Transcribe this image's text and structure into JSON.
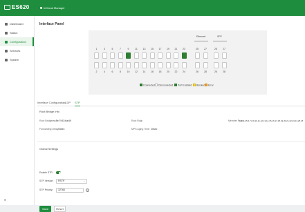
{
  "app": {
    "logo": "ES620",
    "brand": "InCloud Manager"
  },
  "sidebar": {
    "items": [
      {
        "label": "Dashboard",
        "icon": "dashboard-icon"
      },
      {
        "label": "Status",
        "icon": "status-icon"
      },
      {
        "label": "Configuration",
        "icon": "configuration-icon",
        "active": true
      },
      {
        "label": "Services",
        "icon": "services-icon"
      },
      {
        "label": "System",
        "icon": "system-icon"
      }
    ],
    "collapse_glyph": "≡"
  },
  "page": {
    "title": "Interface Panel"
  },
  "panel": {
    "top_ports": [
      "1",
      "3",
      "5",
      "7",
      "9",
      "11",
      "13",
      "15",
      "17",
      "19",
      "21",
      "23"
    ],
    "bottom_ports": [
      "2",
      "4",
      "6",
      "8",
      "10",
      "12",
      "14",
      "16",
      "18",
      "20",
      "22",
      "24"
    ],
    "connected_top": [
      "9",
      "23"
    ],
    "ethernet": {
      "label": "Ethernet",
      "ports": [
        "25",
        "27"
      ],
      "bottom_ports": [
        "26",
        "28"
      ]
    },
    "sfp": {
      "label": "SFP",
      "ports": [
        "25",
        "27"
      ],
      "bottom_ports": [
        "26",
        "28"
      ]
    }
  },
  "legend": {
    "items": [
      {
        "label": "Connected",
        "color": "#2e7d32"
      },
      {
        "label": "Disconnected",
        "color": "#ffffff"
      },
      {
        "label": "Port Enabled",
        "color": "#2e7d32"
      },
      {
        "label": "Blocked",
        "color": "#f6d55c"
      },
      {
        "label": "Error",
        "color": "#f0a030"
      }
    ]
  },
  "tabs": {
    "items": [
      "Interface Configuration",
      "LLDP",
      "STP"
    ],
    "active": "STP"
  },
  "root_bridge": {
    "section_label": "Root Bridge Info",
    "root_bridge_label": "Root Bridge:",
    "root_bridge_value": "ec:8e:7f:63:ba:69",
    "root_role_label": "Root Role:",
    "root_role_value": "--",
    "member_label": "Member Ports:",
    "member_value": "1,2,3,4,5,6,7,8,9,10,11,12,13,14,15,16,17,18,19,20,21,22,23,24,25,26,27,28",
    "forward_delay_label": "Forwarding Delay:",
    "forward_delay_value": "15sec",
    "max_age_label": "MPS Aging Time:",
    "max_age_value": "20sec"
  },
  "global": {
    "section_label": "Global Settings",
    "enable_label": "Enable STP:",
    "enabled": true,
    "version_label": "STP Version:",
    "version_value": "RSTP",
    "priority_label": "STP Priority:",
    "priority_value": "32768",
    "info_glyph": "i"
  },
  "buttons": {
    "save": "Save",
    "reset": "Reset"
  }
}
